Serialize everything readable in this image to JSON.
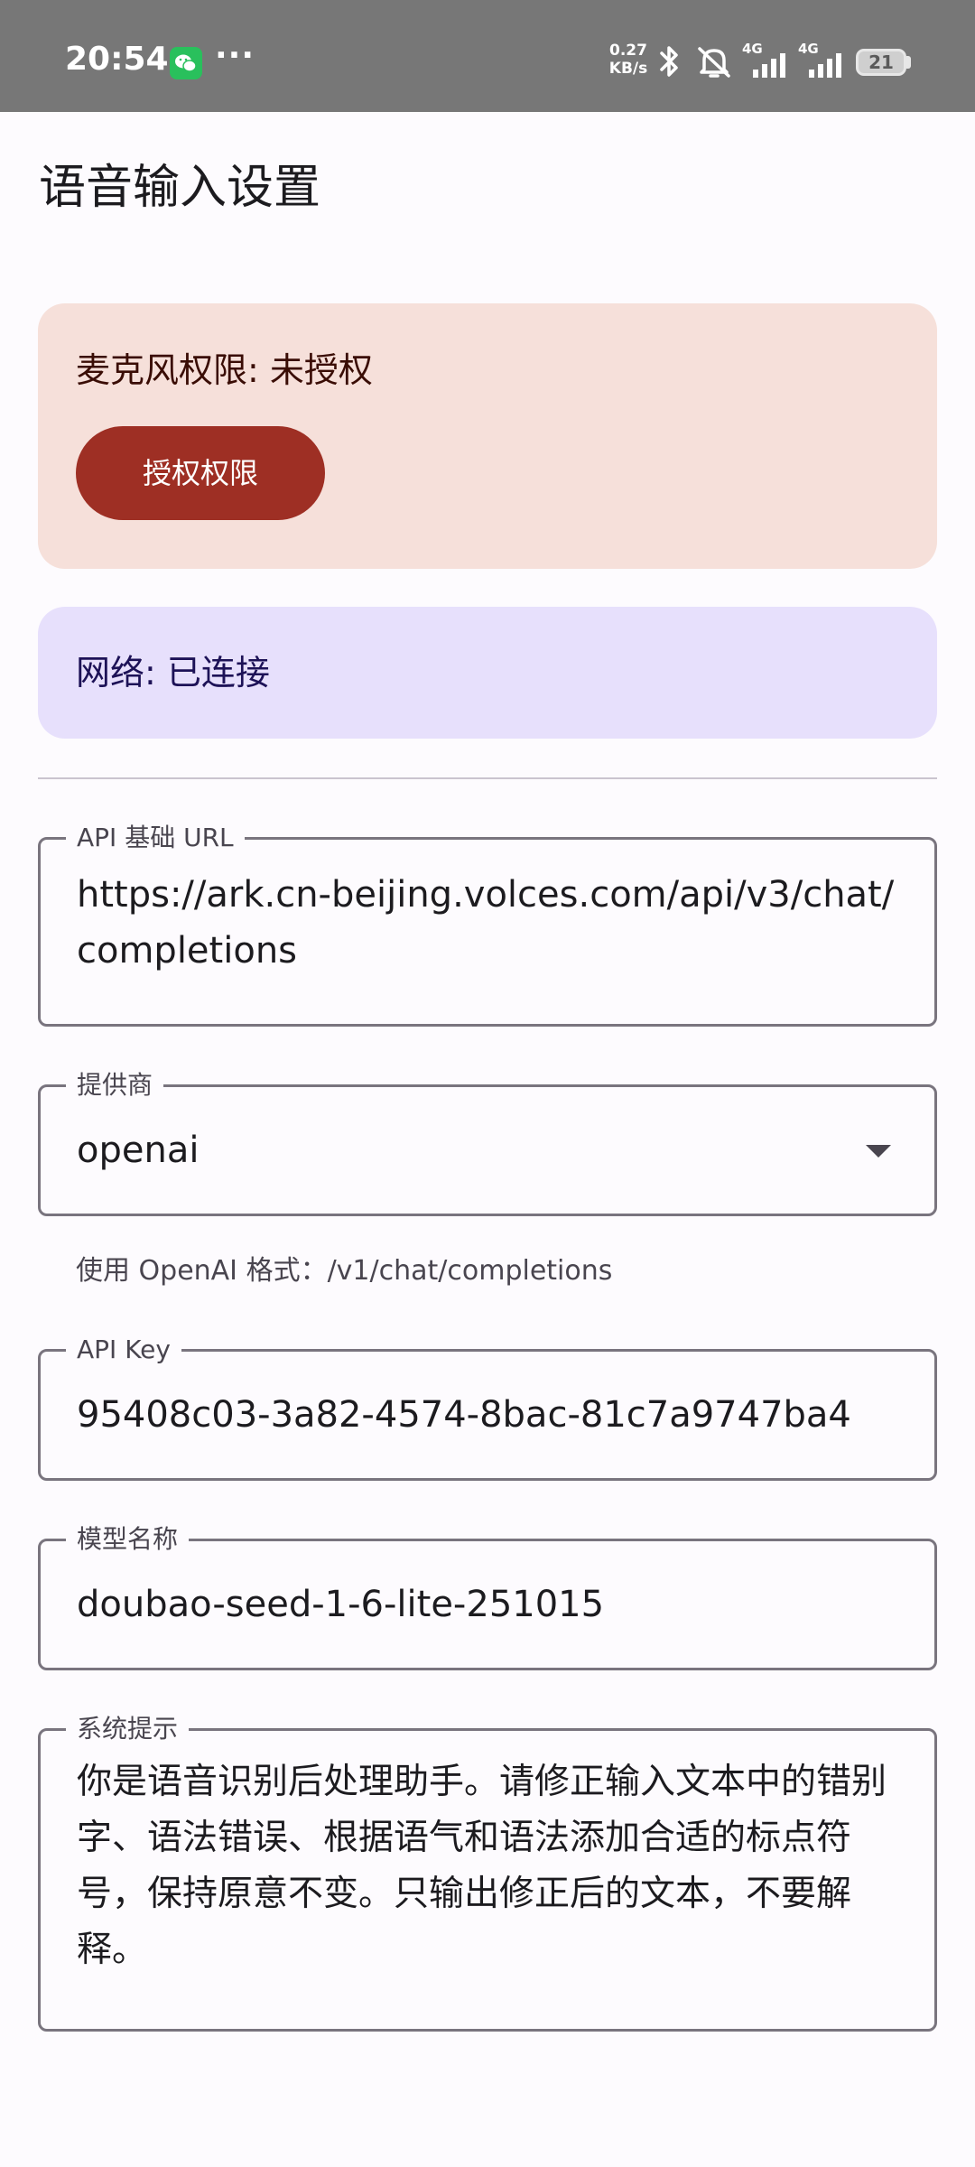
{
  "status_bar": {
    "time": "20:54",
    "more_indicator": "···",
    "net_speed_value": "0.27",
    "net_speed_unit": "KB/s",
    "network_type_1": "4G",
    "network_type_2": "4G",
    "battery_level": "21",
    "icons": [
      "wechat-icon",
      "bluetooth-icon",
      "mute-icon",
      "signal-icon",
      "signal-icon",
      "battery-icon"
    ]
  },
  "page": {
    "title": "语音输入设置"
  },
  "mic_card": {
    "text": "麦克风权限: 未授权",
    "button_label": "授权权限",
    "background": "#f6e0da",
    "button_color": "#9e2f24"
  },
  "network_card": {
    "text": "网络: 已连接",
    "background": "#e7e0fc"
  },
  "form": {
    "api_url": {
      "label": "API 基础 URL",
      "value": "https://ark.cn-beijing.volces.com/api/v3/chat/completions"
    },
    "provider": {
      "label": "提供商",
      "value": "openai",
      "helper": "使用 OpenAI 格式：/v1/chat/completions"
    },
    "api_key": {
      "label": "API Key",
      "value": "95408c03-3a82-4574-8bac-81c7a9747ba4"
    },
    "model": {
      "label": "模型名称",
      "value": "doubao-seed-1-6-lite-251015"
    },
    "system_prompt": {
      "label": "系统提示",
      "value": "你是语音识别后处理助手。请修正输入文本中的错别字、语法错误、根据语气和语法添加合适的标点符号，保持原意不变。只输出修正后的文本，不要解释。"
    }
  }
}
